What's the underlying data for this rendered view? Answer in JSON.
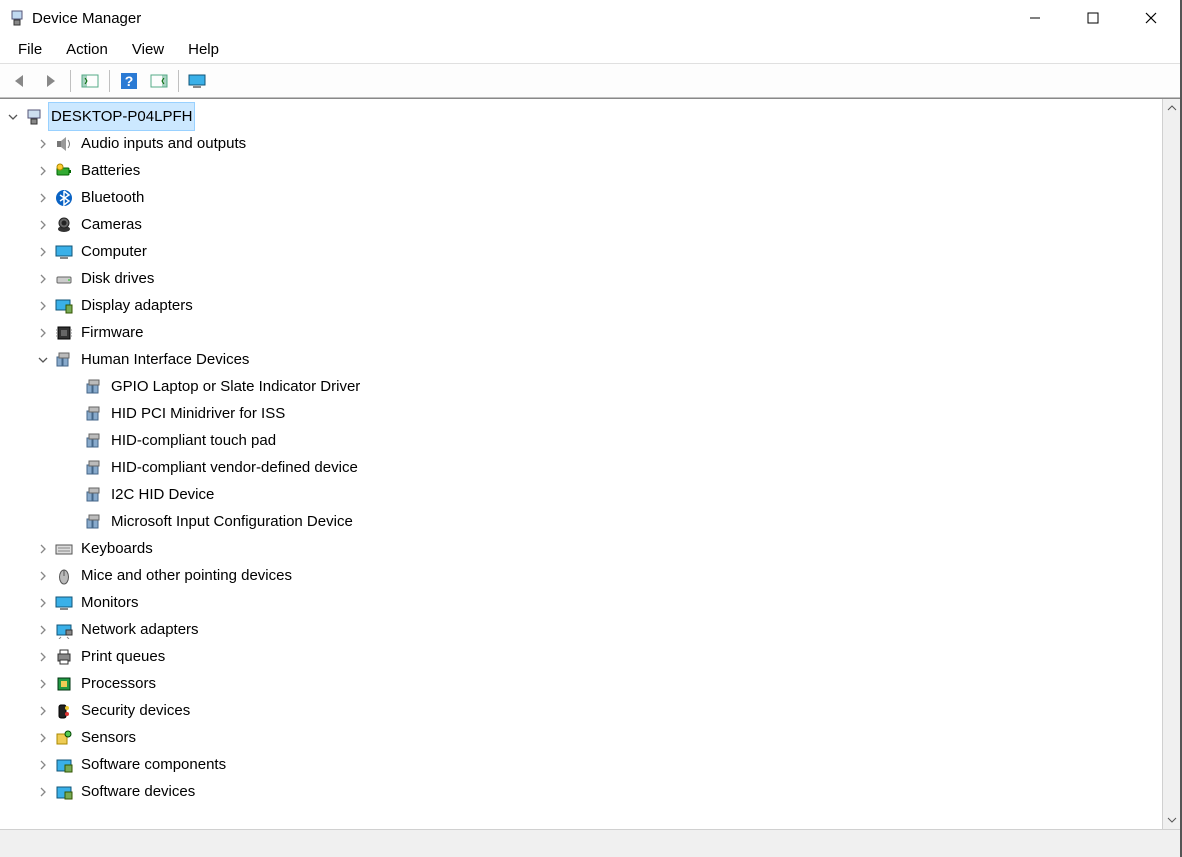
{
  "window": {
    "title": "Device Manager"
  },
  "menu": {
    "file": "File",
    "action": "Action",
    "view": "View",
    "help": "Help"
  },
  "tree": {
    "root": {
      "label": "DESKTOP-P04LPFH",
      "expanded": true,
      "icon": "computer-root"
    },
    "categories": [
      {
        "label": "Audio inputs and outputs",
        "icon": "speaker",
        "expanded": false
      },
      {
        "label": "Batteries",
        "icon": "battery",
        "expanded": false
      },
      {
        "label": "Bluetooth",
        "icon": "bluetooth",
        "expanded": false
      },
      {
        "label": "Cameras",
        "icon": "camera",
        "expanded": false
      },
      {
        "label": "Computer",
        "icon": "monitor",
        "expanded": false
      },
      {
        "label": "Disk drives",
        "icon": "disk",
        "expanded": false
      },
      {
        "label": "Display adapters",
        "icon": "display-adapter",
        "expanded": false
      },
      {
        "label": "Firmware",
        "icon": "chip",
        "expanded": false
      },
      {
        "label": "Human Interface Devices",
        "icon": "hid",
        "expanded": true,
        "children": [
          {
            "label": "GPIO Laptop or Slate Indicator Driver",
            "icon": "hid-device"
          },
          {
            "label": "HID PCI Minidriver for ISS",
            "icon": "hid-device"
          },
          {
            "label": "HID-compliant touch pad",
            "icon": "hid-device"
          },
          {
            "label": "HID-compliant vendor-defined device",
            "icon": "hid-device"
          },
          {
            "label": "I2C HID Device",
            "icon": "hid-device"
          },
          {
            "label": "Microsoft Input Configuration Device",
            "icon": "hid-device"
          }
        ]
      },
      {
        "label": "Keyboards",
        "icon": "keyboard",
        "expanded": false
      },
      {
        "label": "Mice and other pointing devices",
        "icon": "mouse",
        "expanded": false
      },
      {
        "label": "Monitors",
        "icon": "monitor",
        "expanded": false
      },
      {
        "label": "Network adapters",
        "icon": "network",
        "expanded": false
      },
      {
        "label": "Print queues",
        "icon": "printer",
        "expanded": false
      },
      {
        "label": "Processors",
        "icon": "cpu",
        "expanded": false
      },
      {
        "label": "Security devices",
        "icon": "security",
        "expanded": false
      },
      {
        "label": "Sensors",
        "icon": "sensor",
        "expanded": false
      },
      {
        "label": "Software components",
        "icon": "software",
        "expanded": false
      },
      {
        "label": "Software devices",
        "icon": "software",
        "expanded": false
      }
    ]
  }
}
